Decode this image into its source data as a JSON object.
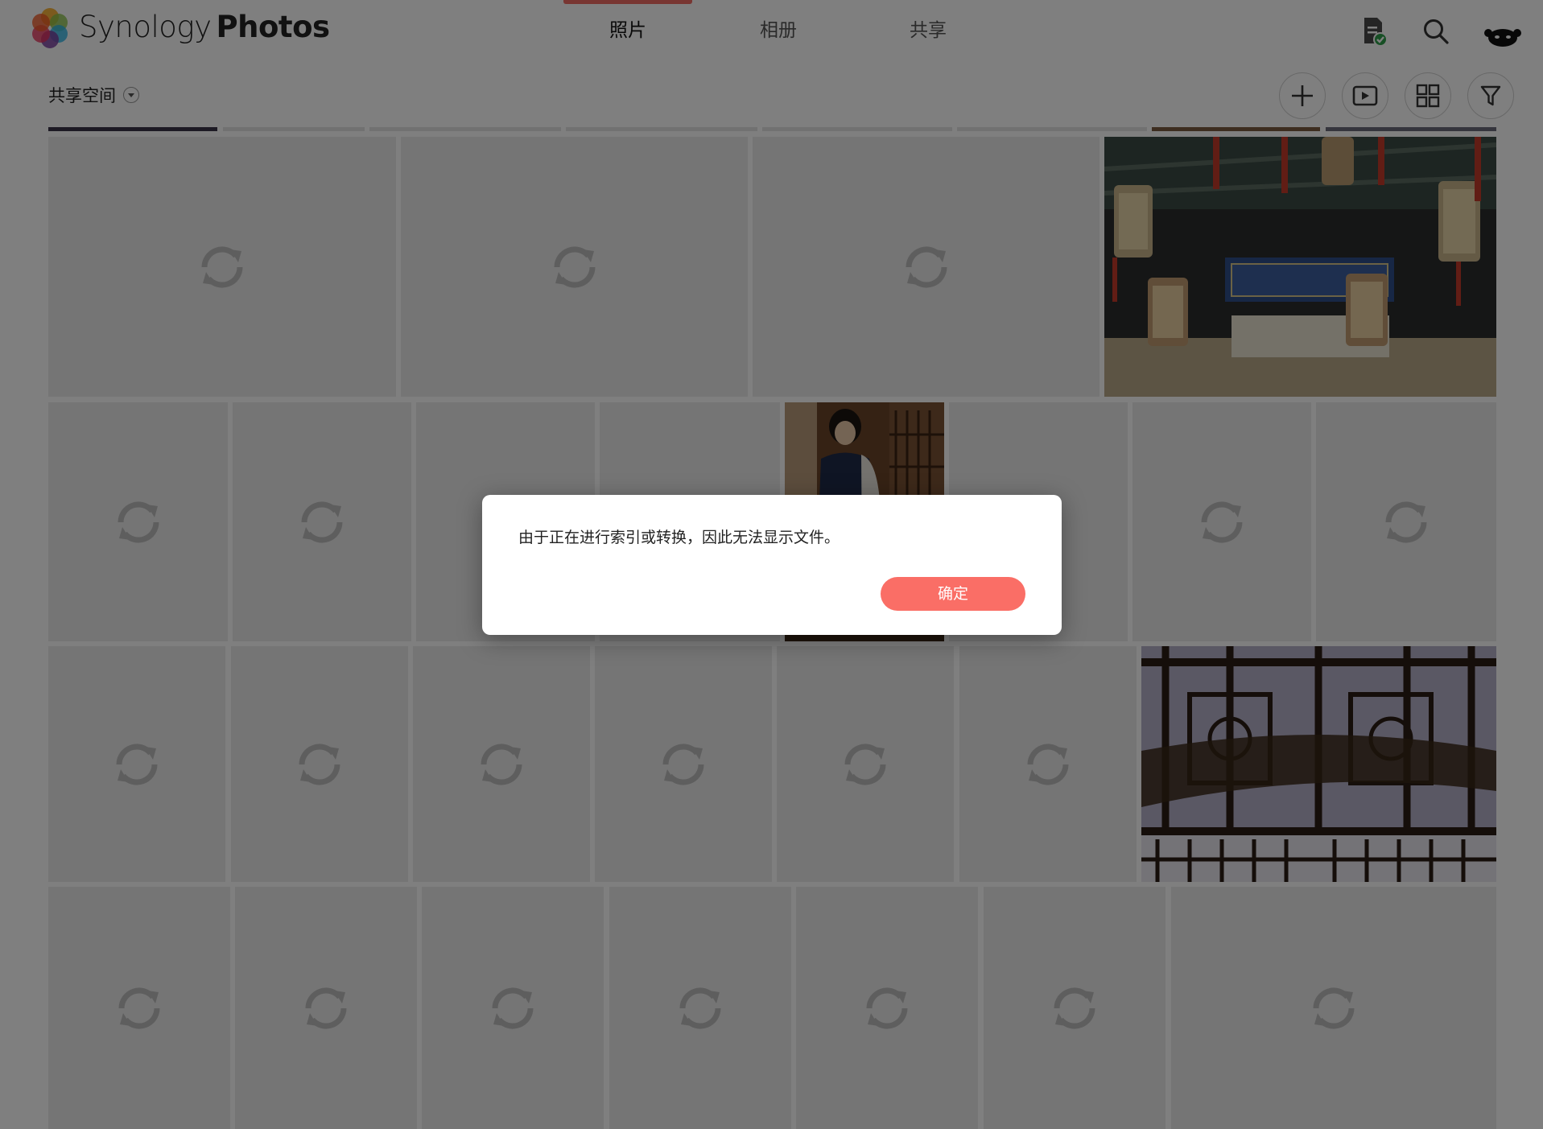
{
  "header": {
    "app_name_part1": "Synology",
    "app_name_part2": "Photos",
    "tabs": [
      {
        "label": "照片",
        "active": true
      },
      {
        "label": "相册",
        "active": false
      },
      {
        "label": "共享",
        "active": false
      }
    ],
    "icons": [
      "task-status-icon",
      "search-icon",
      "user-avatar-icon"
    ]
  },
  "toolbar": {
    "space_label": "共享空间",
    "buttons": [
      "add-icon",
      "slideshow-icon",
      "grid-view-icon",
      "filter-icon"
    ]
  },
  "dialog": {
    "message": "由于正在进行索引或转换，因此无法显示文件。",
    "ok_label": "确定"
  },
  "colors": {
    "accent": "#f06c64",
    "button": "#fa6e66",
    "placeholder_tile": "#eaeaea",
    "sync_icon": "#bdbdbd",
    "overlay": "rgba(0,0,0,0.5)"
  }
}
